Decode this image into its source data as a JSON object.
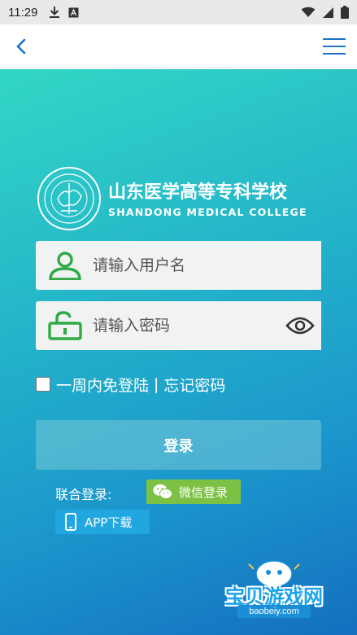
{
  "status_bar": {
    "time": "11:29",
    "icons_left": [
      "download-icon",
      "a-badge-icon"
    ],
    "icons_right": [
      "wifi-icon",
      "signal-icon",
      "battery-icon"
    ]
  },
  "app_bar": {
    "back_icon": "chevron-left-icon",
    "menu_icon": "hamburger-menu-icon",
    "accent_color": "#1a73c9"
  },
  "logo": {
    "title_cn": "山东医学高等专科学校",
    "title_en": "SHANDONG MEDICAL COLLEGE"
  },
  "form": {
    "username_placeholder": "请输入用户名",
    "password_placeholder": "请输入密码",
    "remember_label": "一周内免登陆",
    "separator": "|",
    "forgot_label": "忘记密码",
    "login_button": "登录",
    "icon_color": "#2faa45"
  },
  "social": {
    "union_label": "联合登录:",
    "wechat_label": "微信登录",
    "app_label": "APP下载",
    "wechat_color": "#7cc143",
    "app_color": "#21a7e0"
  },
  "watermark": {
    "text": "宝贝游戏网",
    "url": "baobeiy.com"
  }
}
